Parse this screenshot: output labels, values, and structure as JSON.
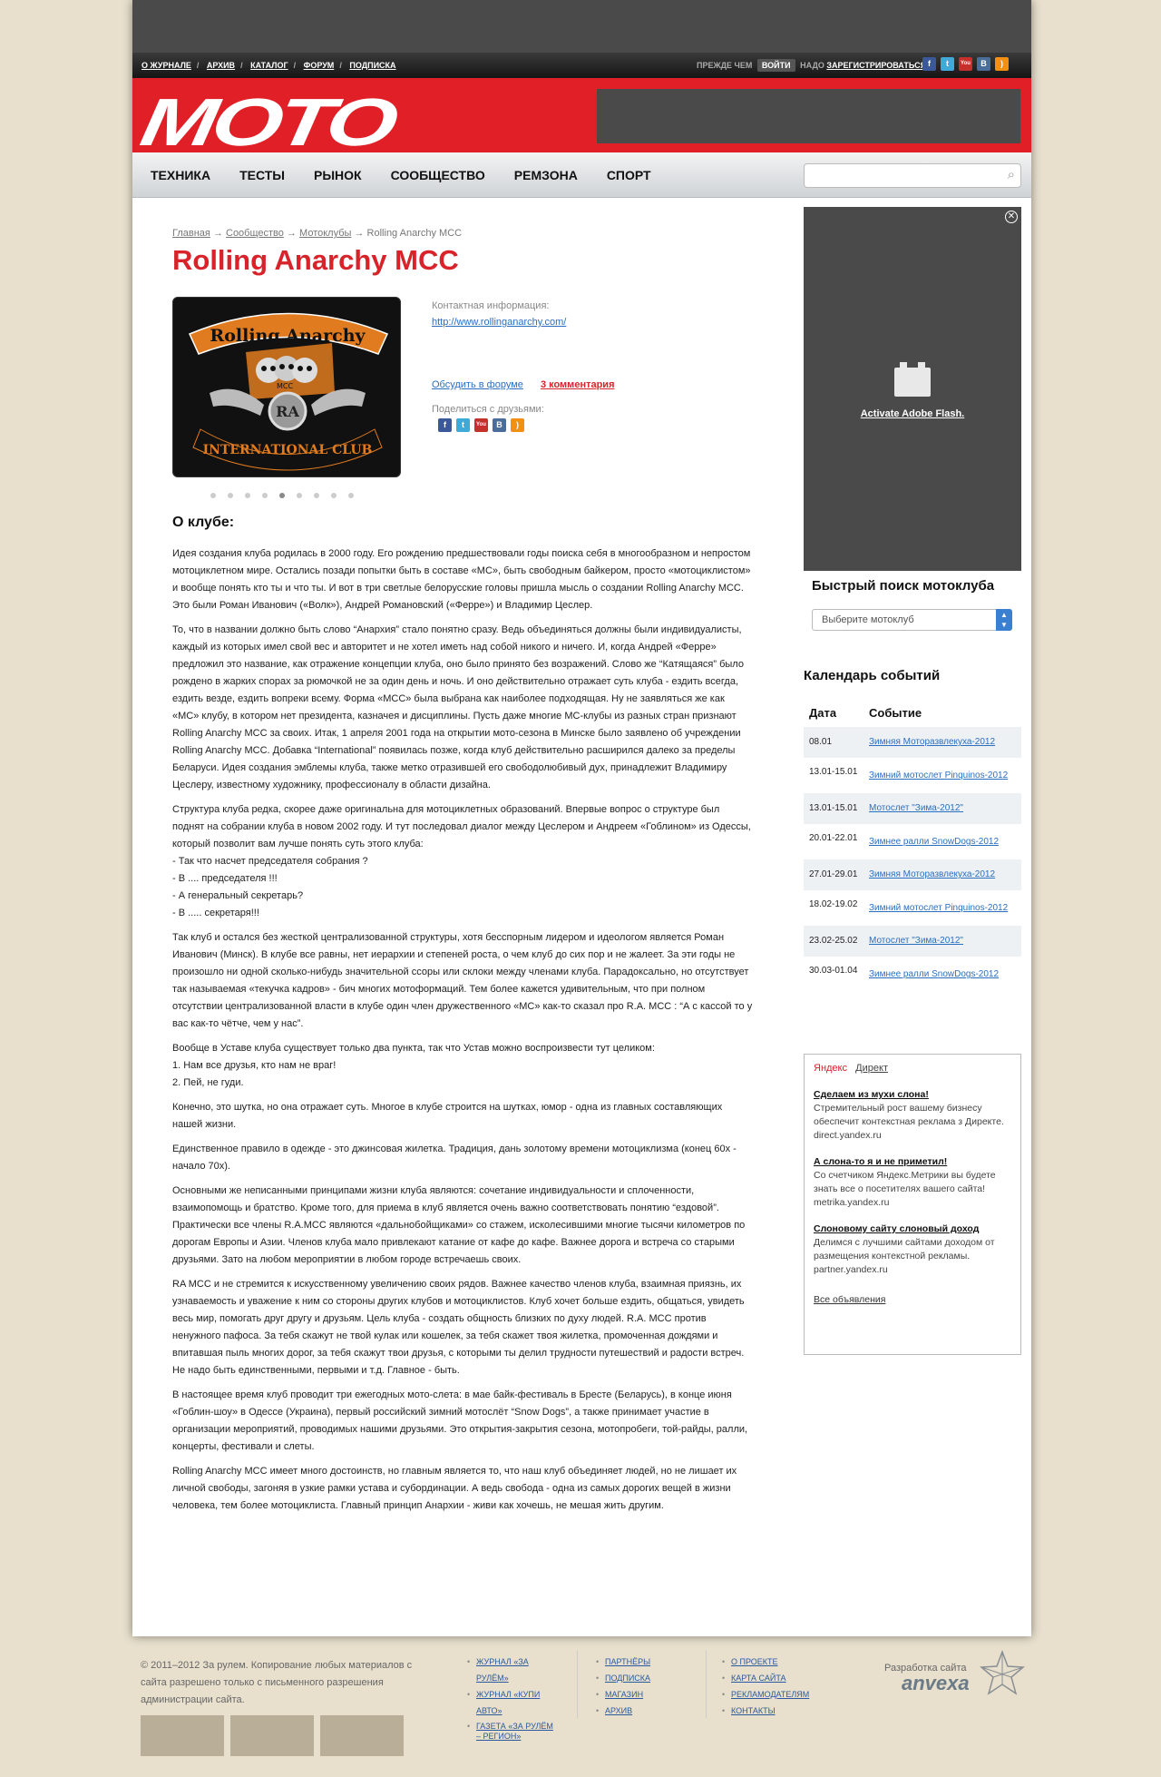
{
  "topnav": {
    "links": [
      "О ЖУРНАЛЕ",
      "АРХИВ",
      "КАТАЛОГ",
      "ФОРУМ",
      "ПОДПИСКА"
    ],
    "before": "ПРЕЖДЕ ЧЕМ",
    "login": "ВОЙТИ",
    "need": "НАДО",
    "register": "ЗАРЕГИСТРИРОВАТЬСЯ"
  },
  "logo": "MOTO",
  "menu": [
    "ТЕХНИКА",
    "ТЕСТЫ",
    "РЫНОК",
    "СООБЩЕСТВО",
    "РЕМЗОНА",
    "СПОРТ"
  ],
  "breadcrumb": {
    "home": "Главная",
    "community": "Сообщество",
    "clubs": "Мотоклубы",
    "current": "Rolling Anarchy MCC",
    "arrow": "→"
  },
  "title": "Rolling Anarchy MCC",
  "patch": {
    "top": "Rolling Anarchy",
    "center": "RA",
    "bottom": "INTERNATIONAL CLUB",
    "small": "MCC"
  },
  "info": {
    "contact_label": "Контактная информация:",
    "url": "http://www.rollinganarchy.com/",
    "discuss": "Обсудить в форуме",
    "comments": "3 комментария",
    "share": "Поделиться с друзьями:"
  },
  "about_title": "О клубе:",
  "paragraphs": [
    "Идея создания клуба родилась в 2000 году. Его рождению предшествовали годы поиска себя в многообразном и непростом мотоциклетном мире. Остались позади попытки быть в составе «МС», быть свободным байкером, просто «мотоциклистом» и вообще понять кто ты и что ты. И вот в три светлые белорусские головы пришла мысль о создании Rolling Anarchy MCC. Это были Роман Иванович («Волк»), Андрей Романовский («Ферре») и Владимир Цеслер.",
    "То, что в названии должно быть слово “Анархия” стало понятно сразу. Ведь объединяться должны были индивидуалисты, каждый из которых имел свой вес и авторитет и не хотел иметь над собой никого и ничего. И, когда Андрей «Ферре» предложил это название, как отражение концепции клуба, оно было принято без возражений. Слово же “Катящаяся” было рождено в жарких спорах за рюмочкой не за один день и ночь. И оно действительно отражает суть клуба - ездить всегда, ездить везде, ездить вопреки всему. Форма «МСС» была выбрана как наиболее подходящая. Ну не заявляться же как «МС» клубу, в котором нет президента, казначея и дисциплины. Пусть даже многие МС-клубы из разных стран признают Rolling Anarchy MCC за своих. Итак, 1 апреля 2001 года на открытии мото-сезона в Минске было заявлено об учреждении Rolling Anarchy MCC. Добавка “International” появилась позже, когда клуб действительно расширился далеко за пределы Беларуси. Идея создания эмблемы клуба, также метко отразившей его свободолюбивый дух, принадлежит Владимиру Цеслеру, известному художнику, профессионалу в области дизайна.",
    "Структура клуба редка, скорее даже оригинальна для мотоциклетных образований. Впервые вопрос о структуре был поднят на собрании клуба в новом 2002 году. И тут последовал диалог между Цеслером и Андреем «Гоблином» из Одессы, который позволит вам лучше понять суть этого клуба:\n- Так что насчет председателя собрания ?\n- В .... председателя !!!\n- А генеральный секретарь?\n- В ..... секретаря!!!",
    "Так клуб и остался без жесткой централизованной структуры, хотя бесспорным лидером и идеологом является Роман Иванович (Минск). В клубе все равны, нет иерархии и степеней роста, о чем клуб до сих пор и не жалеет. За эти годы не произошло ни одной сколько-нибудь значительной ссоры или склоки между членами клуба. Парадоксально, но отсутствует так называемая «текучка кадров» - бич многих мотоформаций. Тем более кажется удивительным, что при полном отсутствии централизованной власти в клубе один член дружественного «МС» как-то сказал про R.A. MCC : “А с кассой то у вас как-то чётче, чем у нас”.",
    "Вообще в Уставе клуба существует только два пункта, так что Устав можно воспроизвести тут целиком:\n1. Нам все друзья, кто нам не враг!\n2. Пей, не гуди.",
    "Конечно, это шутка, но она отражает суть. Многое в клубе строится на шутках, юмор - одна из главных составляющих нашей жизни.",
    "Единственное правило в одежде - это джинсовая жилетка. Традиция, дань золотому времени мотоциклизма (конец 60х - начало 70х).",
    "Основными же неписанными принципами жизни клуба являются: сочетание индивидуальности и сплоченности, взаимопомощь и братство. Кроме того, для приема в клуб является очень важно соответствовать понятию “ездовой”. Практически все члены R.A.MCC являются «дальнобойщиками» со стажем, исколесившими многие тысячи километров по дорогам Европы и Азии. Членов клуба мало привлекают катание от кафе до кафе. Важнее дорога и встреча со старыми друзьями. Зато на любом мероприятии в любом городе встречаешь своих.",
    "RA MCC и не стремится к искусственному увеличению своих рядов. Важнее качество членов клуба, взаимная приязнь, их узнаваемость и уважение к ним со стороны других клубов и мотоциклистов. Клуб хочет больше ездить, общаться, увидеть весь мир, помогать друг другу и друзьям. Цель клуба - создать общность близких по духу людей. R.A. MCC против ненужного пафоса. За тебя скажут не твой кулак или кошелек, за тебя скажет твоя жилетка, промоченная дождями и впитавшая пыль многих дорог, за тебя скажут твои друзья, с которыми ты делил трудности путешествий и радости встреч. Не надо быть единственными, первыми и т.д. Главное - быть.",
    "В настоящее время клуб проводит три ежегодных мото-слета: в мае байк-фестиваль в Бресте (Беларусь), в конце июня «Гоблин-шоу» в Одессе (Украина), первый российский зимний мотослёт “Snow Dogs”, а также принимает участие в организации мероприятий, проводимых нашими друзьями. Это открытия-закрытия сезона, мотопробеги, той-райды, ралли, концерты, фестивали и слеты.",
    "Rolling Anarchy MCC имеет много достоинств, но главным является то, что наш клуб объединяет людей, но не лишает их личной свободы, загоняя в узкие рамки устава и субординации. А ведь свобода - одна из самых дорогих вещей в жизни человека, тем более мотоциклиста. Главный принцип Анархии - живи как хочешь, не мешая жить другим."
  ],
  "flash": {
    "activate": "Activate Adobe Flash."
  },
  "quick_search": {
    "title": "Быстрый поиск мотоклуба",
    "placeholder": "Выберите мотоклуб"
  },
  "calendar": {
    "title": "Календарь событий",
    "col_date": "Дата",
    "col_event": "Событие",
    "rows": [
      {
        "date": "08.01",
        "event": "Зимняя Моторазвлекуха-2012"
      },
      {
        "date": "13.01-15.01",
        "event": "Зимний мотослет Pinquinos-2012"
      },
      {
        "date": "13.01-15.01",
        "event": "Мотослет \"Зима-2012\""
      },
      {
        "date": "20.01-22.01",
        "event": "Зимнее ралли SnowDogs-2012"
      },
      {
        "date": "27.01-29.01",
        "event": "Зимняя Моторазвлекуха-2012"
      },
      {
        "date": "18.02-19.02",
        "event": "Зимний мотослет Pinquinos-2012"
      },
      {
        "date": "23.02-25.02",
        "event": "Мотослет \"Зима-2012\""
      },
      {
        "date": "30.03-01.04",
        "event": "Зимнее ралли SnowDogs-2012"
      }
    ]
  },
  "yandex": {
    "brand": "Яндекс",
    "direct": "Директ",
    "ads": [
      {
        "title": "Сделаем из мухи слона!",
        "text": "Стремительный рост вашему бизнесу обеспечит контекстная реклама з Директе.",
        "site": "direct.yandex.ru"
      },
      {
        "title": "А слона-то я и не приметил!",
        "text": "Со счетчиком Яндекс.Метрики вы будете знать все о посетителях вашего сайта!",
        "site": "metrika.yandex.ru"
      },
      {
        "title": "Слоновому сайту слоновый доход",
        "text": "Делимся с лучшими сайтами доходом от размещения контекстной рекламы.",
        "site": "partner.yandex.ru"
      }
    ],
    "all": "Все объявления"
  },
  "footer": {
    "copyright": "© 2011–2012 За рулем. Копирование любых материалов с сайта разрешено только с письменного разрешения администрации сайта.",
    "col1": [
      "ЖУРНАЛ «ЗА РУЛЁМ»",
      "ЖУРНАЛ «КУПИ АВТО»",
      "ГАЗЕТА «ЗА РУЛЁМ – РЕГИОН»"
    ],
    "col2": [
      "ПАРТНЁРЫ",
      "ПОДПИСКА",
      "МАГАЗИН",
      "АРХИВ"
    ],
    "col3": [
      "О ПРОЕКТЕ",
      "КАРТА САЙТА",
      "РЕКЛАМОДАТЕЛЯМ",
      "КОНТАКТЫ"
    ],
    "dev": "Разработка сайта",
    "dev_brand": "anvexa"
  },
  "colors": {
    "brand_red": "#e01f26",
    "link": "#2a6fc0",
    "bg": "#e8e0cd"
  }
}
